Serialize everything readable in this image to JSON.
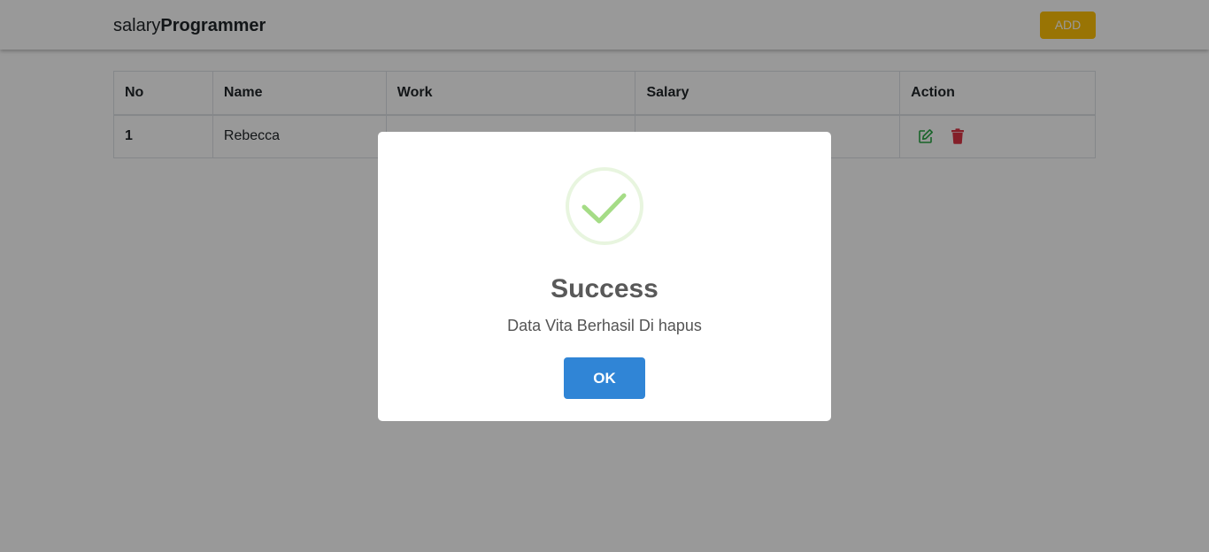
{
  "navbar": {
    "brand_light": "salary",
    "brand_bold": "Programmer",
    "add_label": "ADD",
    "add_color": "#ffc107"
  },
  "table": {
    "headers": [
      "No",
      "Name",
      "Work",
      "Salary",
      "Action"
    ],
    "rows": [
      {
        "no": "1",
        "name": "Rebecca",
        "work": "",
        "salary": "",
        "actions": [
          "edit-icon",
          "trash-icon"
        ]
      }
    ],
    "edit_color": "#28a745",
    "delete_color": "#dc3545"
  },
  "dialog": {
    "icon": "success-check-icon",
    "icon_color": "#a5dc86",
    "title": "Success",
    "message": "Data Vita Berhasil Di hapus",
    "ok_label": "OK",
    "ok_color": "#3085d6"
  }
}
